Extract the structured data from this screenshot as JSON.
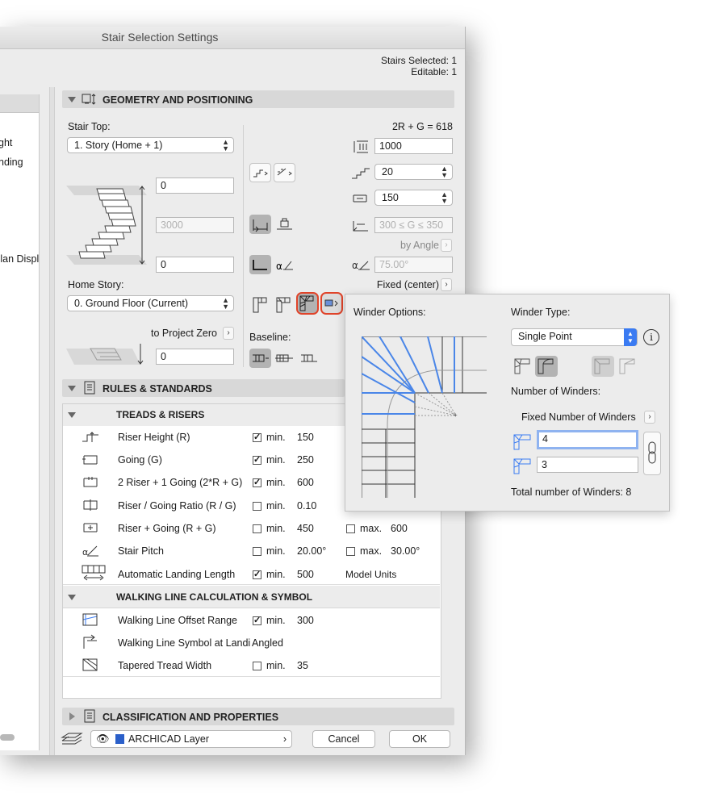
{
  "window": {
    "title": "Stair Selection Settings",
    "stairs_selected": "Stairs Selected: 1",
    "editable": "Editable: 1"
  },
  "left_panel": {
    "items": [
      "ght",
      "nding",
      "Plan Displ"
    ]
  },
  "geometry": {
    "section_title": "GEOMETRY AND POSITIONING",
    "stair_top_label": "Stair Top:",
    "stair_top_value": "1. Story (Home + 1)",
    "top_offset": "0",
    "height_value": "3000",
    "bottom_offset": "0",
    "home_story_label": "Home Story:",
    "home_story_value": "0. Ground Floor (Current)",
    "to_project_zero": "to Project Zero",
    "project_zero_value": "0",
    "rule_formula": "2R + G = 618",
    "total_height": "1000",
    "riser_count": "20",
    "going_value": "150",
    "going_range": "300 ≤ G ≤ 350",
    "by_angle": "by Angle",
    "angle_value": "75.00°",
    "fixed_center": "Fixed (center)",
    "baseline_label": "Baseline:"
  },
  "rules": {
    "section_title": "RULES & STANDARDS",
    "treads_header": "TREADS & RISERS",
    "rows": [
      {
        "label": "Riser Height (R)",
        "checked": true,
        "min_label": "min.",
        "min": "150"
      },
      {
        "label": "Going (G)",
        "checked": true,
        "min_label": "min.",
        "min": "250"
      },
      {
        "label": "2 Riser + 1 Going (2*R + G)",
        "checked": true,
        "min_label": "min.",
        "min": "600"
      },
      {
        "label": "Riser / Going Ratio (R / G)",
        "checked": false,
        "min_label": "min.",
        "min": "0.10"
      },
      {
        "label": "Riser + Going (R + G)",
        "checked": false,
        "min_label": "min.",
        "min": "450",
        "max_label": "max.",
        "max": "600"
      },
      {
        "label": "Stair Pitch",
        "checked": false,
        "min_label": "min.",
        "min": "20.00°",
        "max_label": "max.",
        "max": "30.00°"
      },
      {
        "label": "Automatic Landing Length",
        "checked": true,
        "min_label": "min.",
        "min": "500",
        "extra": "Model Units"
      }
    ],
    "walking_header": "WALKING LINE CALCULATION & SYMBOL",
    "walking_rows": [
      {
        "label": "Walking Line Offset Range",
        "checked": true,
        "min_label": "min.",
        "min": "300"
      },
      {
        "label": "Walking Line Symbol at Landi",
        "value": "Angled"
      },
      {
        "label": "Tapered Tread Width",
        "checked": false,
        "min_label": "min.",
        "min": "35"
      }
    ]
  },
  "classification": {
    "section_title": "CLASSIFICATION AND PROPERTIES"
  },
  "footer": {
    "layer": "ARCHICAD Layer",
    "cancel": "Cancel",
    "ok": "OK"
  },
  "popup": {
    "winder_options": "Winder Options:",
    "winder_type_label": "Winder Type:",
    "winder_type_value": "Single Point",
    "number_of_winders": "Number of Winders:",
    "fixed_number": "Fixed Number of Winders",
    "winders_a": "4",
    "winders_b": "3",
    "total": "Total number of Winders: 8"
  },
  "colors": {
    "highlight": "#e0442a",
    "accent_blue": "#3a7bf2",
    "winder_line": "#4a86e8"
  }
}
